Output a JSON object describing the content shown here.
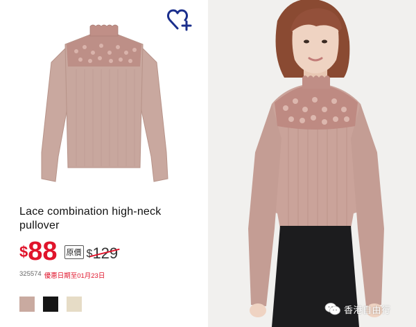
{
  "product": {
    "title": "Lace combination high-neck pullover",
    "price": {
      "currency": "$",
      "value": "88"
    },
    "original_price": {
      "badge": "原價",
      "currency": "$",
      "value": "129"
    },
    "item_code": "325574",
    "promo": "優惠日期至01月23日"
  },
  "swatches": [
    {
      "color": "#c9aaa0",
      "label": "pink"
    },
    {
      "color": "#151515",
      "label": "black"
    },
    {
      "color": "#e6dcc6",
      "label": "beige"
    }
  ],
  "watermark": {
    "text": "香港自由行"
  },
  "colors": {
    "accent": "#e0142b",
    "wishlist_icon": "#1a2e8c",
    "garment": "#c9a89f"
  },
  "icons": {
    "wishlist": "heart-plus-icon",
    "watermark": "wechat-icon"
  }
}
